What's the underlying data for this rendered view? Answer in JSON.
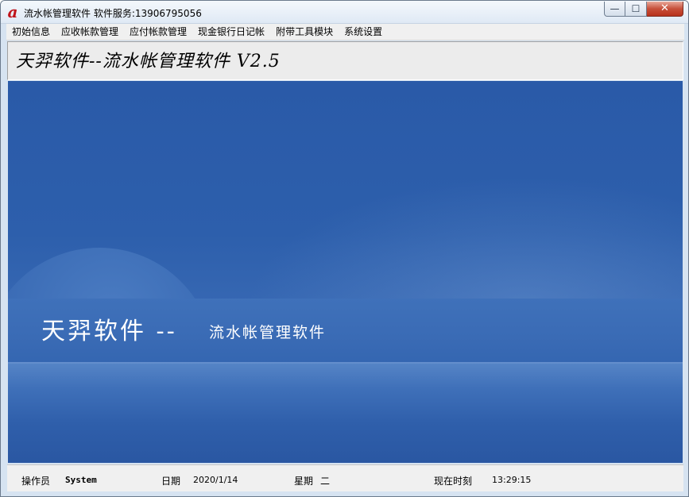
{
  "window": {
    "title": "流水帐管理软件  软件服务:13906795056",
    "app_icon_glyph": "a",
    "buttons": {
      "minimize": "—",
      "maximize": "☐",
      "close": "✕"
    }
  },
  "menu": {
    "items": [
      {
        "label": "初始信息"
      },
      {
        "label": "应收帐款管理"
      },
      {
        "label": "应付帐款管理"
      },
      {
        "label": "现金银行日记帐"
      },
      {
        "label": "附带工具模块"
      },
      {
        "label": "系统设置"
      }
    ]
  },
  "header": {
    "title": "天羿软件--流水帐管理软件 V2.5"
  },
  "splash": {
    "brand": "天羿软件 --",
    "subtitle": "流水帐管理软件",
    "colors": {
      "background": "#2a5aa8",
      "text": "#ffffff"
    }
  },
  "status": {
    "operator_label": "操作员",
    "operator_value": "System",
    "date_label": "日期",
    "date_value": "2020/1/14",
    "weekday_label": "星期",
    "weekday_value": "二",
    "time_label": "现在时刻",
    "time_value": "13:29:15"
  }
}
